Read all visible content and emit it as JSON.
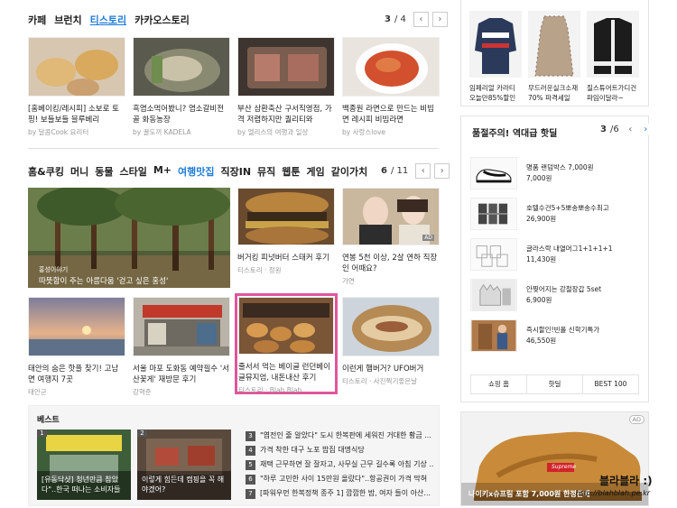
{
  "section1": {
    "tabs": [
      "카페",
      "브런치",
      "티스토리",
      "카카오스토리"
    ],
    "active_tab": "티스토리",
    "page_current": "3",
    "page_total": "/ 4",
    "cards": [
      {
        "title": "[홈베이킹/레시피] 소보로 토핑! 보들보들 블루베리",
        "source": "by 달콤Cook 요리터"
      },
      {
        "title": "흑염소먹어봤니? 염소갈비전골 화동농장",
        "source": "by 꿀도끼 KADELA"
      },
      {
        "title": "부산 삼환축산 구서직영점, 가격 저렴하지만 퀄리티와",
        "source": "by 엘리스의 여행과 일상"
      },
      {
        "title": "백종원 라면으로 만드는 비빔면 레시피 비빔라면",
        "source": "by 사랑스love"
      }
    ]
  },
  "section2": {
    "tabs": [
      "홈&쿠킹",
      "머니",
      "동물",
      "스타일",
      "M+",
      "여행맛집",
      "직장IN",
      "뮤직",
      "웹툰",
      "게임",
      "같이가치"
    ],
    "active_tab": "여행맛집",
    "page_current": "6",
    "page_total": "/ 11",
    "big_card": {
      "tag": "홍성이야기",
      "title": "따뜻함이 주는 아름다움 '걷고 싶은 홍성'"
    },
    "cards": [
      {
        "title": "버거킹 피넛버터 스태커 후기",
        "source": "티스토리 · 정원"
      },
      {
        "title": "연봉 5천 이상, 2살 연하 직장인 어때요?",
        "source": "가연",
        "ad": "AD"
      },
      {
        "title": "태안의 숨은 핫플 찾기! 고남면 여행지 7곳",
        "source": "태안군"
      },
      {
        "title": "서울 마포 도화동 예약필수 '서산꽃게' 재방문 후기",
        "source": "강혁준"
      },
      {
        "title": "줄서서 먹는 베이글 런던베이글뮤지엄, 내돈내산 후기",
        "source": "티스토리 · Blah Blah"
      },
      {
        "title": "이런게 햄버거? UFO버거",
        "source": "티스토리 · 사진찍기좋은날"
      }
    ]
  },
  "best": {
    "heading": "베스트",
    "cards": [
      {
        "rank": "1",
        "title": "[유동닥샷] 청년만큼 참았다\"..한국 떠나는 소비자들"
      },
      {
        "rank": "2",
        "title": "이렇게 힘든데 캠핑을 꼭 해야겠어?"
      }
    ],
    "list": [
      {
        "rank": "3",
        "text": "\"엽전인 줄 알았다\" 도시 한복판에 세워진 거대한 황금 ..."
      },
      {
        "rank": "4",
        "text": "가격 착한 대구 노포 밥집 대명식당"
      },
      {
        "rank": "5",
        "text": "재택 근무하면 잘 잘자고, 사무실 근무 길수록 아침 기상 ..."
      },
      {
        "rank": "6",
        "text": "\"하루 고민한 사이 15만원 올랐다\"..항공권이 가격 막혀"
      },
      {
        "rank": "7",
        "text": "[파워우먼 한복정책 종주 1] 깜깜한 밤, 여자 들이 아산..."
      }
    ]
  },
  "shop_top": {
    "items": [
      {
        "title": "임페리얼 카라티 오늘만85%할인"
      },
      {
        "title": "무드러운실크소재 70% 파격세일"
      },
      {
        "title": "질스튜어트가디건 파임이달라~"
      }
    ]
  },
  "hot": {
    "title": "품절주의! 역대급 핫딜",
    "page_current": "3",
    "page_total": "/6",
    "items": [
      {
        "name": "명품 랜덤박스 7,000원",
        "price": "7,000원"
      },
      {
        "name": "호텔수건5+5뽀송뽀송수최고",
        "price": "26,900원"
      },
      {
        "name": "글라스락 내열머그1+1+1+1",
        "price": "11,430원"
      },
      {
        "name": "안찢어지는 강철장갑 5set",
        "price": "6,900원"
      },
      {
        "name": "즉시할인!빈폴 신학기특가",
        "price": "46,550원"
      }
    ],
    "footer": [
      "쇼핑 홈",
      "핫딜",
      "BEST 100"
    ]
  },
  "ad_banner": {
    "badge": "AD",
    "caption": "나이키x슈프림 포함 7,000원 한정판매",
    "brand": "Supreme"
  },
  "watermark": {
    "title": "블라블라 :)",
    "url": "http://blahblah.pe.kr"
  },
  "colors": {
    "accent": "#1e7bd8",
    "highlight_border": "#e0569b"
  }
}
